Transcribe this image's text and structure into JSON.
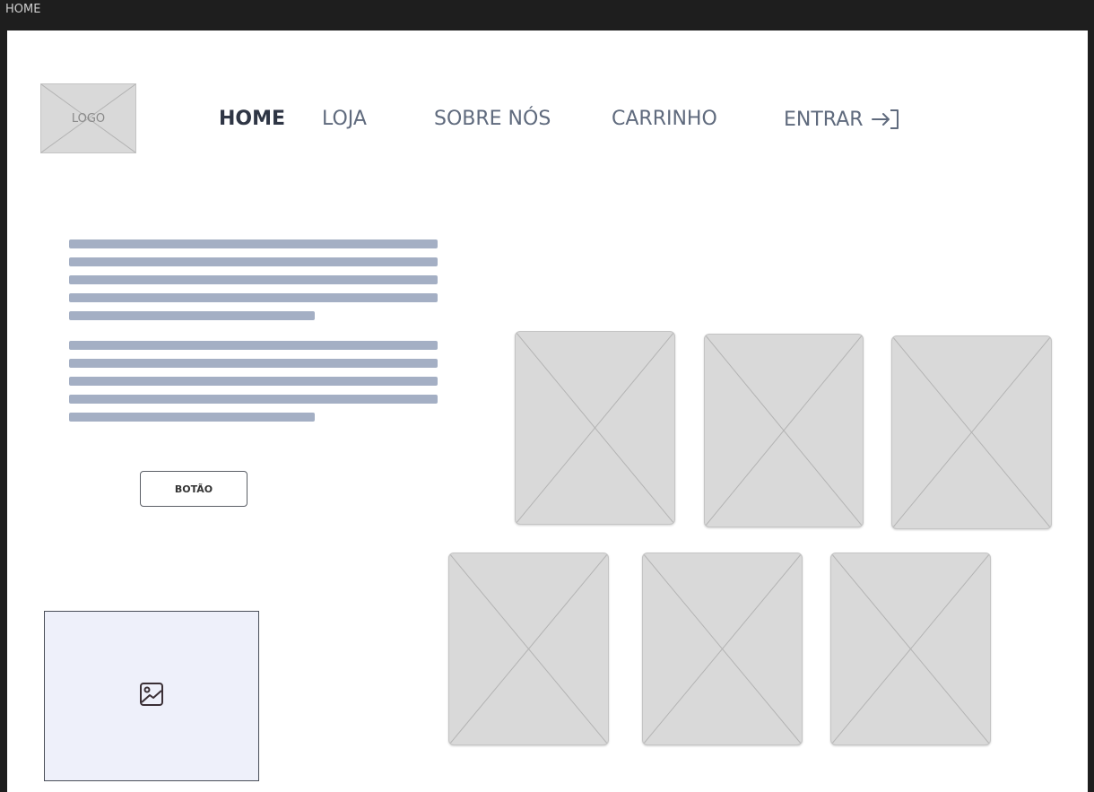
{
  "window": {
    "title": "HOME"
  },
  "header": {
    "logo_label": "LOGO",
    "nav": [
      {
        "label": "HOME",
        "active": true
      },
      {
        "label": "LOJA",
        "active": false
      },
      {
        "label": "SOBRE NÓS",
        "active": false
      },
      {
        "label": "CARRINHO",
        "active": false
      },
      {
        "label": "ENTRAR",
        "active": false,
        "icon": "login-arrow-icon"
      }
    ]
  },
  "main": {
    "cta_label": "BOTÃO",
    "image_icon": "image-icon",
    "product_placeholders": 6
  },
  "colors": {
    "text_placeholder": "#a4afc4",
    "placeholder_fill": "#d9d9d9",
    "image_widget_bg": "#eef0fa",
    "nav_text": "#5f6a7d",
    "nav_active": "#2f3645"
  }
}
